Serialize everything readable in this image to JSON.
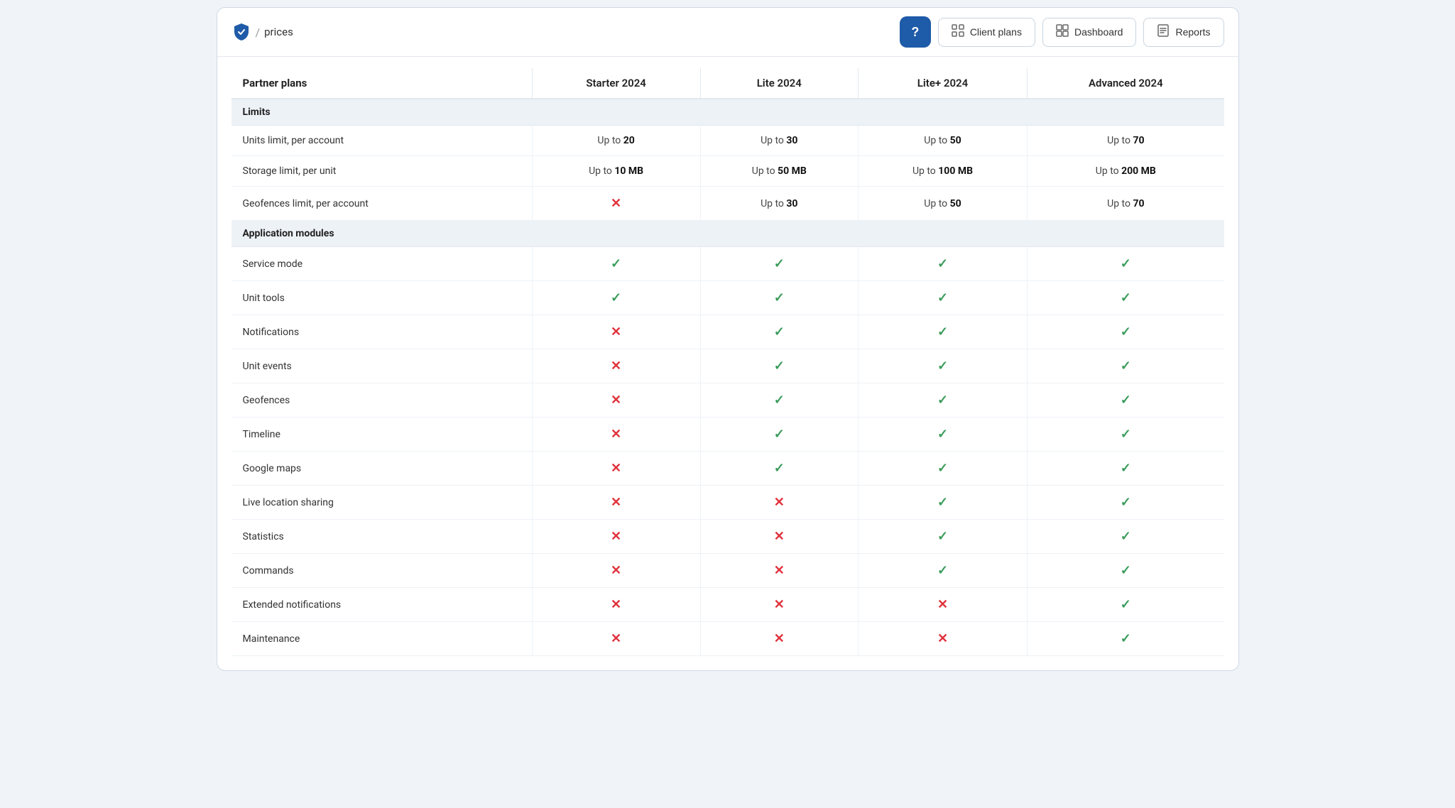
{
  "header": {
    "logo_alt": "Shield logo",
    "breadcrumb_separator": "/",
    "breadcrumb_label": "prices",
    "help_label": "?",
    "nav_buttons": [
      {
        "id": "client-plans",
        "icon": "⊞",
        "label": "Client plans"
      },
      {
        "id": "dashboard",
        "icon": "⊞",
        "label": "Dashboard"
      },
      {
        "id": "reports",
        "icon": "⊟",
        "label": "Reports"
      }
    ]
  },
  "table": {
    "columns": [
      {
        "id": "feature",
        "label": "Partner plans"
      },
      {
        "id": "starter",
        "label": "Starter 2024"
      },
      {
        "id": "lite",
        "label": "Lite 2024"
      },
      {
        "id": "lite_plus",
        "label": "Lite+ 2024"
      },
      {
        "id": "advanced",
        "label": "Advanced 2024"
      }
    ],
    "sections": [
      {
        "id": "limits",
        "label": "Limits",
        "rows": [
          {
            "feature": "Units limit, per account",
            "starter": {
              "type": "text",
              "value": "Up to",
              "bold": "20"
            },
            "lite": {
              "type": "text",
              "value": "Up to",
              "bold": "30"
            },
            "lite_plus": {
              "type": "text",
              "value": "Up to",
              "bold": "50"
            },
            "advanced": {
              "type": "text",
              "value": "Up to",
              "bold": "70"
            }
          },
          {
            "feature": "Storage limit, per unit",
            "starter": {
              "type": "text",
              "value": "Up to",
              "bold": "10 MB"
            },
            "lite": {
              "type": "text",
              "value": "Up to",
              "bold": "50 MB"
            },
            "lite_plus": {
              "type": "text",
              "value": "Up to",
              "bold": "100 MB"
            },
            "advanced": {
              "type": "text",
              "value": "Up to",
              "bold": "200 MB"
            }
          },
          {
            "feature": "Geofences limit, per account",
            "starter": {
              "type": "cross"
            },
            "lite": {
              "type": "text",
              "value": "Up to",
              "bold": "30"
            },
            "lite_plus": {
              "type": "text",
              "value": "Up to",
              "bold": "50"
            },
            "advanced": {
              "type": "text",
              "value": "Up to",
              "bold": "70"
            }
          }
        ]
      },
      {
        "id": "app_modules",
        "label": "Application modules",
        "rows": [
          {
            "feature": "Service mode",
            "starter": {
              "type": "check"
            },
            "lite": {
              "type": "check"
            },
            "lite_plus": {
              "type": "check"
            },
            "advanced": {
              "type": "check"
            }
          },
          {
            "feature": "Unit tools",
            "starter": {
              "type": "check"
            },
            "lite": {
              "type": "check"
            },
            "lite_plus": {
              "type": "check"
            },
            "advanced": {
              "type": "check"
            }
          },
          {
            "feature": "Notifications",
            "starter": {
              "type": "cross"
            },
            "lite": {
              "type": "check"
            },
            "lite_plus": {
              "type": "check"
            },
            "advanced": {
              "type": "check"
            }
          },
          {
            "feature": "Unit events",
            "starter": {
              "type": "cross"
            },
            "lite": {
              "type": "check"
            },
            "lite_plus": {
              "type": "check"
            },
            "advanced": {
              "type": "check"
            }
          },
          {
            "feature": "Geofences",
            "starter": {
              "type": "cross"
            },
            "lite": {
              "type": "check"
            },
            "lite_plus": {
              "type": "check"
            },
            "advanced": {
              "type": "check"
            }
          },
          {
            "feature": "Timeline",
            "starter": {
              "type": "cross"
            },
            "lite": {
              "type": "check"
            },
            "lite_plus": {
              "type": "check"
            },
            "advanced": {
              "type": "check"
            }
          },
          {
            "feature": "Google maps",
            "starter": {
              "type": "cross"
            },
            "lite": {
              "type": "check"
            },
            "lite_plus": {
              "type": "check"
            },
            "advanced": {
              "type": "check"
            }
          },
          {
            "feature": "Live location sharing",
            "starter": {
              "type": "cross"
            },
            "lite": {
              "type": "cross"
            },
            "lite_plus": {
              "type": "check"
            },
            "advanced": {
              "type": "check"
            }
          },
          {
            "feature": "Statistics",
            "starter": {
              "type": "cross"
            },
            "lite": {
              "type": "cross"
            },
            "lite_plus": {
              "type": "check"
            },
            "advanced": {
              "type": "check"
            }
          },
          {
            "feature": "Commands",
            "starter": {
              "type": "cross"
            },
            "lite": {
              "type": "cross"
            },
            "lite_plus": {
              "type": "check"
            },
            "advanced": {
              "type": "check"
            }
          },
          {
            "feature": "Extended notifications",
            "starter": {
              "type": "cross"
            },
            "lite": {
              "type": "cross"
            },
            "lite_plus": {
              "type": "cross"
            },
            "advanced": {
              "type": "check"
            }
          },
          {
            "feature": "Maintenance",
            "starter": {
              "type": "cross"
            },
            "lite": {
              "type": "cross"
            },
            "lite_plus": {
              "type": "cross"
            },
            "advanced": {
              "type": "check"
            }
          }
        ]
      }
    ]
  }
}
